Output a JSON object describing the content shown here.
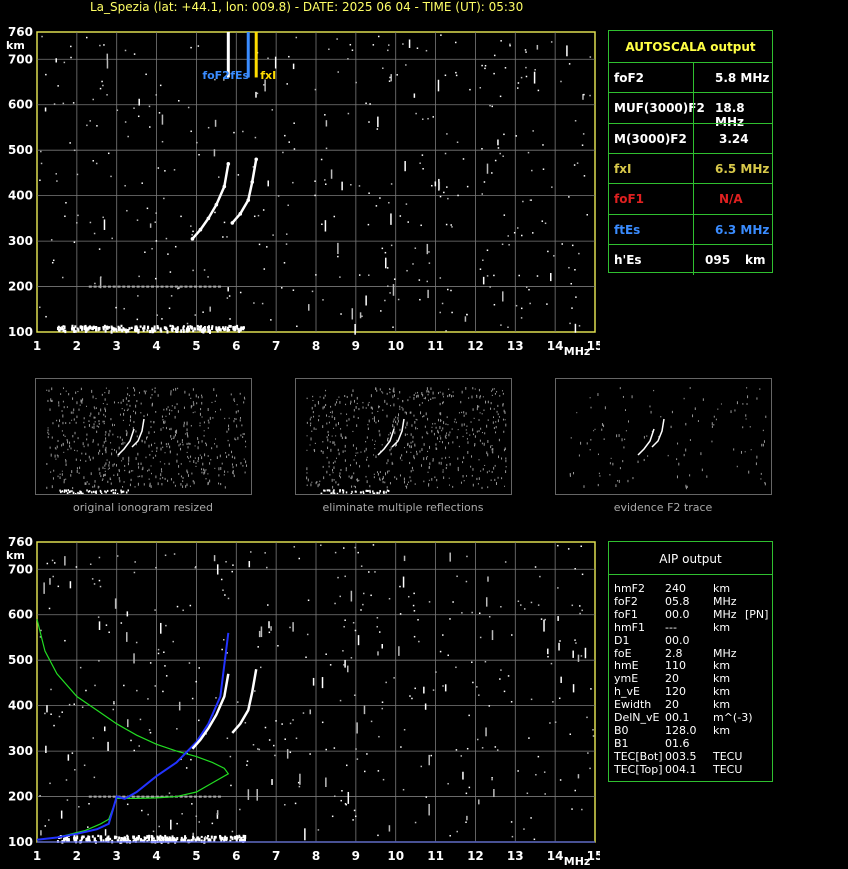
{
  "header": "La_Spezia (lat: +44.1, lon: 009.8) - DATE: 2025 06 04 - TIME (UT): 05:30",
  "axis": {
    "x_unit": "MHz",
    "y_unit": "km",
    "x_ticks": [
      "1",
      "2",
      "3",
      "4",
      "5",
      "6",
      "7",
      "8",
      "9",
      "10",
      "11",
      "12",
      "13",
      "14",
      "15"
    ],
    "y_ticks": [
      "100",
      "200",
      "300",
      "400",
      "500",
      "600",
      "700",
      "760"
    ]
  },
  "markers": {
    "foF2": "foF2",
    "fEs": "fEs",
    "fxI": "fxI"
  },
  "autoscala": {
    "title": "AUTOSCALA output",
    "rows": [
      {
        "label": "foF2",
        "value": "5.8 MHz",
        "color": "#ffffff"
      },
      {
        "label": "MUF(3000)F2",
        "value": "18.8 MHz",
        "color": "#ffffff"
      },
      {
        "label": "M(3000)F2",
        "value": "3.24",
        "color": "#ffffff"
      },
      {
        "label": "fxI",
        "value": "6.5 MHz",
        "color": "#d8c84a"
      },
      {
        "label": "foF1",
        "value": "N/A",
        "color": "#e02020"
      },
      {
        "label": "ftEs",
        "value": "6.3 MHz",
        "color": "#3a8cff"
      },
      {
        "label": "h'Es",
        "value": "095",
        "unit": "km",
        "color": "#ffffff"
      }
    ]
  },
  "thumbnails": [
    {
      "caption": "original ionogram resized"
    },
    {
      "caption": "eliminate multiple reflections"
    },
    {
      "caption": "evidence F2 trace"
    }
  ],
  "aip": {
    "title": "AIP output",
    "rows": [
      {
        "k": "hmF2",
        "v": "240",
        "u": "km",
        "x": ""
      },
      {
        "k": "foF2",
        "v": "05.8",
        "u": "MHz",
        "x": ""
      },
      {
        "k": "foF1",
        "v": "00.0",
        "u": "MHz",
        "x": "[PN]"
      },
      {
        "k": "hmF1",
        "v": "---",
        "u": "km",
        "x": ""
      },
      {
        "k": "D1",
        "v": "00.0",
        "u": "",
        "x": ""
      },
      {
        "k": "foE",
        "v": "2.8",
        "u": "MHz",
        "x": ""
      },
      {
        "k": "hmE",
        "v": "110",
        "u": "km",
        "x": ""
      },
      {
        "k": "ymE",
        "v": "20",
        "u": "km",
        "x": ""
      },
      {
        "k": "h_vE",
        "v": "120",
        "u": "km",
        "x": ""
      },
      {
        "k": "Ewidth",
        "v": "20",
        "u": "km",
        "x": ""
      },
      {
        "k": "DelN_vE",
        "v": "00.1",
        "u": "m^(-3)",
        "x": ""
      },
      {
        "k": "B0",
        "v": "128.0",
        "u": "km",
        "x": ""
      },
      {
        "k": "B1",
        "v": "01.6",
        "u": "",
        "x": ""
      },
      {
        "k": "TEC[Bot]",
        "v": "003.5",
        "u": "TECU",
        "x": ""
      },
      {
        "k": "TEC[Top]",
        "v": "004.1",
        "u": "TECU",
        "x": ""
      }
    ]
  },
  "chart_data": [
    {
      "type": "scatter",
      "xlim": [
        1,
        15
      ],
      "ylim": [
        100,
        760
      ],
      "series": [
        {
          "name": "",
          "x": [
            4.9,
            5.1,
            5.3,
            5.5,
            5.7,
            5.8
          ],
          "y": [
            305,
            325,
            350,
            380,
            420,
            470
          ]
        },
        {
          "name": "",
          "x": [
            5.9,
            6.1,
            6.3,
            6.4,
            6.5
          ],
          "y": [
            340,
            360,
            390,
            430,
            480
          ]
        },
        {
          "name": "",
          "x": [
            1.5,
            2.5,
            3.5,
            4.5,
            5.5,
            6.2
          ],
          "y": [
            108,
            110,
            110,
            108,
            108,
            108
          ]
        }
      ],
      "vlines": [
        {
          "x": 5.8,
          "label": "foF2"
        },
        {
          "x": 6.3,
          "label": "fEs"
        },
        {
          "x": 6.5,
          "label": "fxI"
        }
      ]
    },
    {
      "type": "line",
      "xlim": [
        1,
        15
      ],
      "ylim": [
        100,
        760
      ],
      "series": [
        {
          "name": "",
          "x": [
            1.0,
            1.2,
            1.5,
            2.0,
            2.5,
            3.0,
            3.5,
            4.0,
            4.5,
            5.0,
            5.4,
            5.7,
            5.8,
            5.4,
            5.0,
            4.5,
            4.0,
            3.5,
            3.0,
            2.8,
            2.6,
            2.2,
            1.5,
            1.0
          ],
          "y": [
            590,
            520,
            470,
            420,
            390,
            360,
            335,
            315,
            300,
            288,
            275,
            262,
            250,
            230,
            210,
            200,
            197,
            196,
            196,
            150,
            140,
            125,
            110,
            105
          ]
        },
        {
          "name": "",
          "x": [
            1.0,
            1.5,
            2.0,
            2.5,
            2.8,
            3.0,
            3.2,
            3.5,
            4.0,
            4.5,
            5.0,
            5.3,
            5.6,
            5.8
          ],
          "y": [
            105,
            110,
            118,
            128,
            140,
            200,
            195,
            210,
            245,
            275,
            320,
            360,
            420,
            560
          ]
        }
      ]
    }
  ]
}
